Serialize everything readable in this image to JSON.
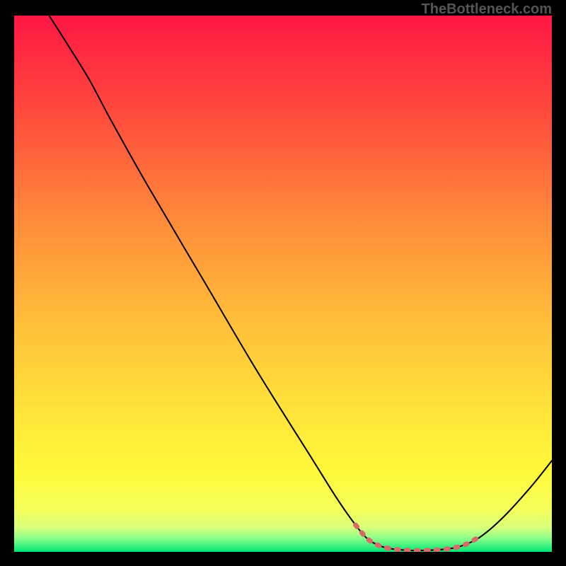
{
  "watermark": "TheBottleneck.com",
  "chart_data": {
    "type": "line",
    "title": "",
    "xlabel": "",
    "ylabel": "",
    "xlim": [
      0,
      100
    ],
    "ylim": [
      0,
      100
    ],
    "gradient_stops": [
      {
        "offset": 0,
        "color": "#ff1744"
      },
      {
        "offset": 18,
        "color": "#ff4a3d"
      },
      {
        "offset": 38,
        "color": "#ff8a3a"
      },
      {
        "offset": 55,
        "color": "#ffb93a"
      },
      {
        "offset": 72,
        "color": "#ffe03a"
      },
      {
        "offset": 85,
        "color": "#fff93a"
      },
      {
        "offset": 92,
        "color": "#f5ff5a"
      },
      {
        "offset": 95.5,
        "color": "#d8ff7a"
      },
      {
        "offset": 97.5,
        "color": "#8aff8a"
      },
      {
        "offset": 100,
        "color": "#00e676"
      }
    ],
    "series": [
      {
        "name": "bottleneck-curve",
        "color": "#000000",
        "width": 2,
        "points": [
          {
            "x": 6.5,
            "y": 100
          },
          {
            "x": 10,
            "y": 94.5
          },
          {
            "x": 14,
            "y": 88
          },
          {
            "x": 18,
            "y": 80.5
          },
          {
            "x": 25,
            "y": 68
          },
          {
            "x": 35,
            "y": 51
          },
          {
            "x": 45,
            "y": 34
          },
          {
            "x": 55,
            "y": 18
          },
          {
            "x": 60,
            "y": 10
          },
          {
            "x": 63.5,
            "y": 5
          },
          {
            "x": 66,
            "y": 2.2
          },
          {
            "x": 69,
            "y": 0.8
          },
          {
            "x": 73,
            "y": 0.3
          },
          {
            "x": 77,
            "y": 0.3
          },
          {
            "x": 81,
            "y": 0.6
          },
          {
            "x": 84,
            "y": 1.4
          },
          {
            "x": 87,
            "y": 3
          },
          {
            "x": 91,
            "y": 6.5
          },
          {
            "x": 96,
            "y": 12
          },
          {
            "x": 100,
            "y": 17
          }
        ]
      },
      {
        "name": "optimal-zone-marker",
        "color": "#d86a6a",
        "width": 7,
        "dashed": true,
        "points": [
          {
            "x": 63.5,
            "y": 5
          },
          {
            "x": 66,
            "y": 2.2
          },
          {
            "x": 69,
            "y": 0.8
          },
          {
            "x": 73,
            "y": 0.3
          },
          {
            "x": 77,
            "y": 0.3
          },
          {
            "x": 81,
            "y": 0.6
          },
          {
            "x": 84,
            "y": 1.4
          },
          {
            "x": 86.5,
            "y": 2.8
          }
        ]
      }
    ]
  }
}
